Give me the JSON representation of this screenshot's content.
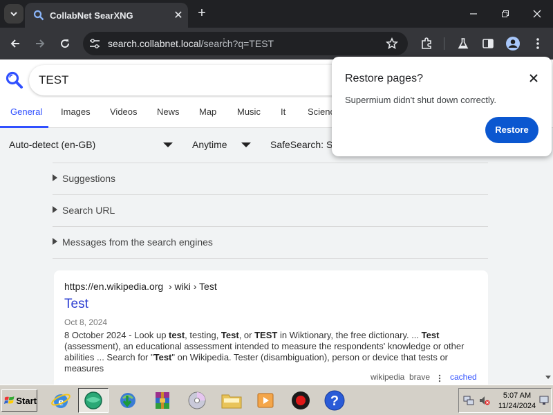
{
  "browser": {
    "tab_title": "CollabNet SearXNG",
    "url_host": "search.collabnet.local",
    "url_path": "/search?q=TEST"
  },
  "search": {
    "query": "TEST"
  },
  "categories": [
    {
      "label": "General",
      "active": true
    },
    {
      "label": "Images"
    },
    {
      "label": "Videos"
    },
    {
      "label": "News"
    },
    {
      "label": "Map"
    },
    {
      "label": "Music"
    },
    {
      "label": "It"
    },
    {
      "label": "Scienc"
    }
  ],
  "filters": {
    "language": "Auto-detect (en-GB)",
    "time": "Anytime",
    "safesearch": "SafeSearch: St"
  },
  "details": [
    {
      "label": "Suggestions"
    },
    {
      "label": "Search URL"
    },
    {
      "label": "Messages from the search engines"
    }
  ],
  "result": {
    "url_base": "https://en.wikipedia.org",
    "url_path": "› wiki › Test",
    "title": "Test",
    "date": "Oct 8, 2024",
    "snippet": [
      {
        "t": "8 October 2024 - Look up ",
        "b": false
      },
      {
        "t": "test",
        "b": true
      },
      {
        "t": ", testing, ",
        "b": false
      },
      {
        "t": "Test",
        "b": true
      },
      {
        "t": ", or ",
        "b": false
      },
      {
        "t": "TEST",
        "b": true
      },
      {
        "t": " in Wiktionary, the free dictionary. ... ",
        "b": false
      },
      {
        "t": "Test",
        "b": true
      },
      {
        "t": " (assessment), an educational assessment intended to measure the respondents' knowledge or other abilities ... Search for \"",
        "b": false
      },
      {
        "t": "Test",
        "b": true
      },
      {
        "t": "\" on Wikipedia. Tester (disambiguation), person or device that tests or measures",
        "b": false
      }
    ],
    "engines": [
      "wikipedia",
      "brave"
    ],
    "cached": "cached"
  },
  "popup": {
    "title": "Restore pages?",
    "message": "Supermium didn't shut down correctly.",
    "button": "Restore"
  },
  "taskbar": {
    "start": "Start",
    "time": "5:07 AM",
    "date": "11/24/2024"
  },
  "colors": {
    "accent": "#3050ff",
    "restore_button": "#0b57d0",
    "chrome_dark": "#202124"
  }
}
